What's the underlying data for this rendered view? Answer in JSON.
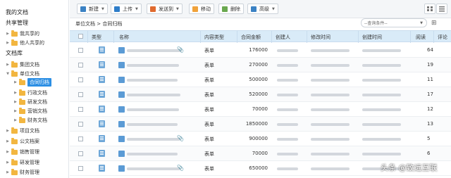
{
  "sidebar": {
    "my_docs": "我的文档",
    "shared_mgmt": "共享管理",
    "shared_items": [
      "我共享的",
      "他人共享的"
    ],
    "library": "文档库",
    "library_items": [
      {
        "label": "集团文档",
        "level": 1
      },
      {
        "label": "单位文档",
        "level": 1,
        "expanded": true
      },
      {
        "label": "合同归档",
        "level": 2,
        "active": true
      },
      {
        "label": "行政文档",
        "level": 2
      },
      {
        "label": "研发文档",
        "level": 2
      },
      {
        "label": "营销文档",
        "level": 2
      },
      {
        "label": "财务文档",
        "level": 2
      },
      {
        "label": "项目文档",
        "level": 1
      },
      {
        "label": "公文档案",
        "level": 1
      },
      {
        "label": "销售管理",
        "level": 1
      },
      {
        "label": "研发管理",
        "level": 1
      },
      {
        "label": "财务管理",
        "level": 1
      }
    ]
  },
  "toolbar": {
    "new": "新建",
    "upload": "上传",
    "send_to": "发送到",
    "move": "移动",
    "delete": "删除",
    "advanced": "高级"
  },
  "breadcrumb": "单位文档 > 合同归档",
  "search": {
    "placeholder": "--查询条件--"
  },
  "table": {
    "headers": {
      "type": "类型",
      "name": "名称",
      "content_type": "内容类型",
      "amount": "合同金额",
      "creator": "创建人",
      "modified": "修改时间",
      "created": "创建时间",
      "reads": "阅读",
      "comments": "评论"
    },
    "rows": [
      {
        "content_type": "表单",
        "amount": "176000",
        "reads": "64",
        "attach": true
      },
      {
        "content_type": "表单",
        "amount": "270000",
        "reads": "19",
        "attach": false
      },
      {
        "content_type": "表单",
        "amount": "500000",
        "reads": "11",
        "attach": false
      },
      {
        "content_type": "表单",
        "amount": "520000",
        "reads": "17",
        "attach": false
      },
      {
        "content_type": "表单",
        "amount": "70000",
        "reads": "12",
        "attach": false
      },
      {
        "content_type": "表单",
        "amount": "1850000",
        "reads": "13",
        "attach": false
      },
      {
        "content_type": "表单",
        "amount": "900000",
        "reads": "5",
        "attach": true
      },
      {
        "content_type": "表单",
        "amount": "70000",
        "reads": "6",
        "attach": false
      },
      {
        "content_type": "表单",
        "amount": "650000",
        "reads": "",
        "attach": true
      }
    ]
  },
  "watermark": "头条 @致远互联"
}
